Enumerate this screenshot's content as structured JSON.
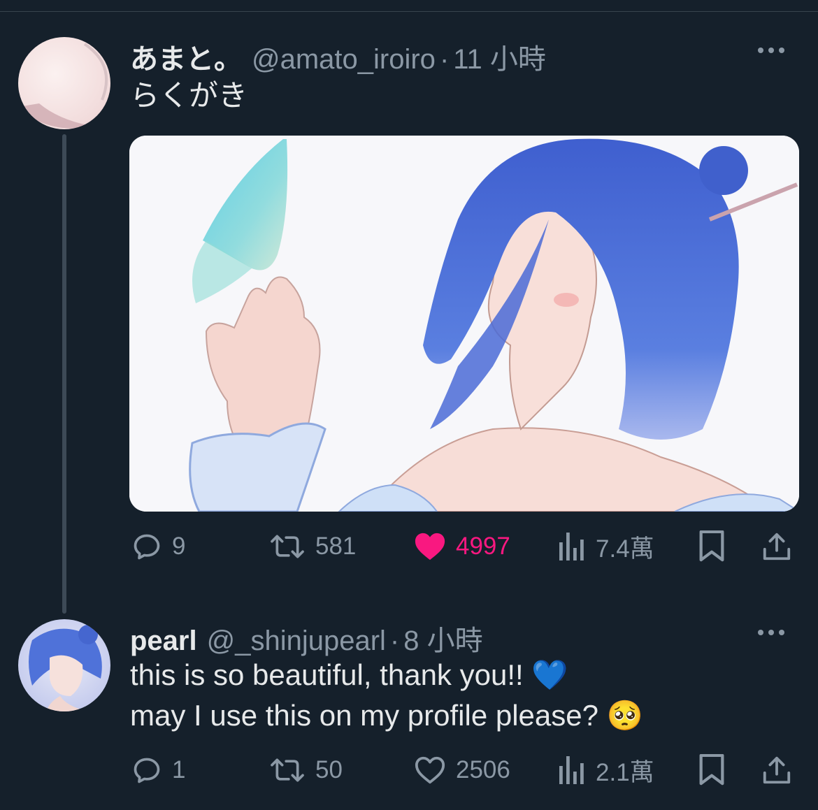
{
  "tweet": {
    "display_name": "あまと。",
    "handle": "@amato_iroiro",
    "separator": "·",
    "time": "11 小時",
    "text": "らくがき",
    "media_alt": "illustration",
    "stats": {
      "replies": "9",
      "reposts": "581",
      "likes": "4997",
      "views": "7.4萬"
    }
  },
  "reply": {
    "display_name": "pearl",
    "handle": "@_shinjupearl",
    "separator": "·",
    "time": "8 小時",
    "text_line1": "this is so beautiful, thank you!! 💙",
    "text_line2": "may I use this on my profile please? 🥺",
    "stats": {
      "replies": "1",
      "reposts": "50",
      "likes": "2506",
      "views": "2.1萬"
    }
  },
  "colors": {
    "background": "#15202b",
    "text_primary": "#e7e9ea",
    "text_secondary": "#8b98a5",
    "like_active": "#f91880"
  },
  "icons": [
    "reply-icon",
    "repost-icon",
    "like-icon",
    "views-icon",
    "bookmark-icon",
    "share-icon",
    "more-icon"
  ]
}
